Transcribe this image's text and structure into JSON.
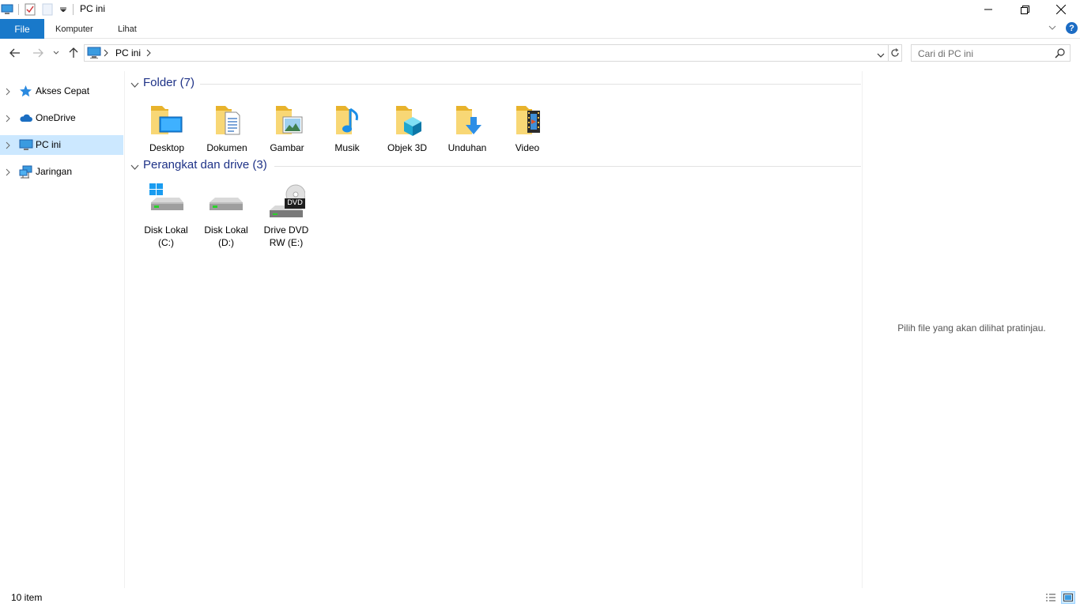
{
  "window": {
    "title": "PC ini",
    "minimize_icon": "minimize-icon",
    "maximize_icon": "restore-icon",
    "close_icon": "close-icon"
  },
  "ribbon": {
    "tabs": [
      {
        "label": "File",
        "active": true
      },
      {
        "label": "Komputer"
      },
      {
        "label": "Lihat"
      }
    ],
    "accent": "#1979ca",
    "help_label": "?"
  },
  "address": {
    "crumbs": [
      "PC ini"
    ],
    "search_placeholder": "Cari di PC ini"
  },
  "nav": {
    "items": [
      {
        "label": "Akses Cepat",
        "icon": "star-icon",
        "selected": false
      },
      {
        "label": "OneDrive",
        "icon": "cloud-icon",
        "selected": false
      },
      {
        "label": "PC ini",
        "icon": "computer-icon",
        "selected": true
      },
      {
        "label": "Jaringan",
        "icon": "network-icon",
        "selected": false
      }
    ],
    "selected_color": "#cce8ff"
  },
  "content": {
    "groups": [
      {
        "title": "Folder (7)",
        "items": [
          {
            "label": "Desktop",
            "icon": "desktop-folder-icon"
          },
          {
            "label": "Dokumen",
            "icon": "documents-folder-icon"
          },
          {
            "label": "Gambar",
            "icon": "pictures-folder-icon"
          },
          {
            "label": "Musik",
            "icon": "music-folder-icon"
          },
          {
            "label": "Objek 3D",
            "icon": "3d-objects-folder-icon"
          },
          {
            "label": "Unduhan",
            "icon": "downloads-folder-icon"
          },
          {
            "label": "Video",
            "icon": "videos-folder-icon"
          }
        ]
      },
      {
        "title": "Perangkat dan drive (3)",
        "items": [
          {
            "label": "Disk Lokal (C:)",
            "line1": "Disk Lokal",
            "line2": "(C:)",
            "icon": "windows-drive-icon"
          },
          {
            "label": "Disk Lokal (D:)",
            "line1": "Disk Lokal",
            "line2": "(D:)",
            "icon": "hard-drive-icon"
          },
          {
            "label": "Drive DVD RW (E:)",
            "line1": "Drive DVD",
            "line2": "RW (E:)",
            "icon": "dvd-drive-icon",
            "badge": "DVD"
          }
        ]
      }
    ],
    "header_color": "#1e3287"
  },
  "preview": {
    "text": "Pilih file yang akan dilihat pratinjau."
  },
  "status": {
    "count": "10 item"
  }
}
